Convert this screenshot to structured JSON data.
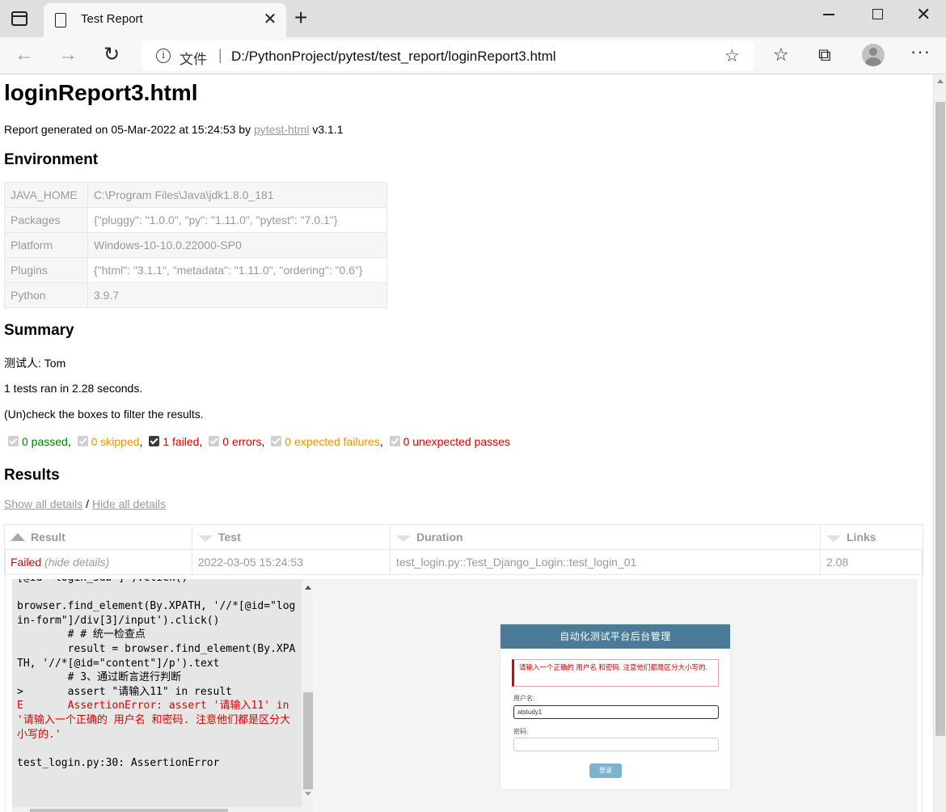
{
  "browser": {
    "tab_title": "Test Report",
    "address_label": "文件",
    "address_separator": "|",
    "url": "D:/PythonProject/pytest/test_report/loginReport3.html"
  },
  "report": {
    "title": "loginReport3.html",
    "generated_prefix": "Report generated on 05-Mar-2022 at 15:24:53 by ",
    "generator_link": "pytest-html",
    "generator_version": " v3.1.1"
  },
  "environment": {
    "heading": "Environment",
    "rows": [
      {
        "key": "JAVA_HOME",
        "value": "C:\\Program Files\\Java\\jdk1.8.0_181"
      },
      {
        "key": "Packages",
        "value": "{\"pluggy\": \"1.0.0\", \"py\": \"1.11.0\", \"pytest\": \"7.0.1\"}"
      },
      {
        "key": "Platform",
        "value": "Windows-10-10.0.22000-SP0"
      },
      {
        "key": "Plugins",
        "value": "{\"html\": \"3.1.1\", \"metadata\": \"1.11.0\", \"ordering\": \"0.6\"}"
      },
      {
        "key": "Python",
        "value": "3.9.7"
      }
    ]
  },
  "summary": {
    "heading": "Summary",
    "tester": "测试人: Tom",
    "ran": "1 tests ran in 2.28 seconds.",
    "filter_hint": "(Un)check the boxes to filter the results.",
    "filters": {
      "passed": "0 passed",
      "skipped": "0 skipped",
      "failed": "1 failed",
      "errors": "0 errors",
      "xfail": "0 expected failures",
      "xpass": "0 unexpected passes"
    }
  },
  "results": {
    "heading": "Results",
    "show_all": "Show all details",
    "slash": " / ",
    "hide_all": "Hide all details",
    "columns": {
      "result": "Result",
      "test": "Test",
      "duration": "Duration",
      "links": "Links"
    },
    "row": {
      "result": "Failed",
      "hide_details": "(hide details)",
      "test": "2022-03-05 15:24:53",
      "duration": "test_login.py::Test_Django_Login::test_login_01",
      "links": "2.08"
    },
    "log_text": "[@id=\"login_sub\"]').click()\n\nbrowser.find_element(By.XPATH, '//*[@id=\"login-form\"]/div[3]/input').click()\n        # # 统一检查点\n        result = browser.find_element(By.XPATH, '//*[@id=\"content\"]/p').text\n        # 3、通过断言进行判断\n>       assert \"请输入11\" in result",
    "log_error": "E       AssertionError: assert '请输入11' in '请输入一个正确的 用户名 和密码. 注意他们都是区分大小写的.'",
    "log_tail": "\n\ntest_login.py:30: AssertionError"
  },
  "screenshot": {
    "header": "自动化测试平台后台管理",
    "alert": "请输入一个正确的 用户名 和密码. 注意他们都是区分大小写的.",
    "username_label": "用户名:",
    "username_value": "atstudy1",
    "password_label": "密码:",
    "login_button": "登录"
  }
}
